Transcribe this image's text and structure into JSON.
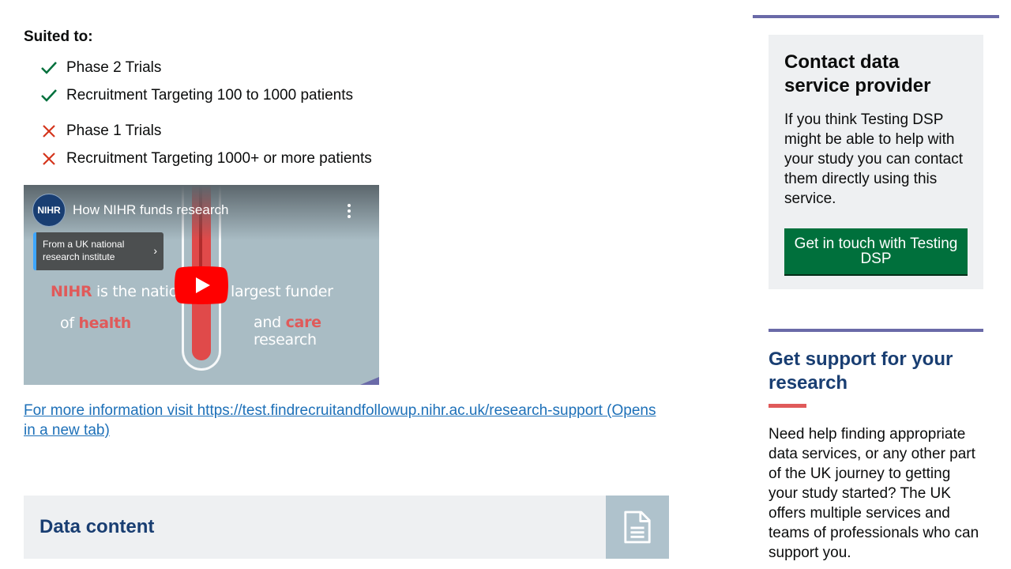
{
  "suited": {
    "heading": "Suited to:",
    "yes": [
      "Phase 2 Trials",
      "Recruitment Targeting 100 to 1000 patients"
    ],
    "no": [
      "Phase 1 Trials",
      "Recruitment Targeting 1000+ or more patients"
    ],
    "yes_color": "#00703c",
    "no_color": "#d4351c"
  },
  "video": {
    "logo_text": "NIHR",
    "title": "How NIHR funds research",
    "info_card": [
      "From a UK national",
      "research institute"
    ],
    "frame_text_1": {
      "brand": "NIHR",
      "middle": " is the nation's",
      "end": "largest funder"
    },
    "frame_text_2": {
      "start": "of ",
      "health": "health",
      "and": "and ",
      "care": "care",
      "end": " research"
    }
  },
  "more_link": "For more information visit https://test.findrecruitandfollowup.nihr.ac.uk/research-support (Opens in a new tab)",
  "data_content": {
    "title": "Data content",
    "icon": "document-icon"
  },
  "sidebar": {
    "contact": {
      "title": "Contact data service provider",
      "body": "If you think Testing DSP might be able to help with your study you can contact them directly using this service.",
      "button": "Get in touch with Testing DSP"
    },
    "support": {
      "title": "Get support for your research",
      "body": "Need help finding appropriate data services, or any other part of the UK journey to getting your study started? The UK offers multiple services and teams of professionals who can support you."
    }
  }
}
